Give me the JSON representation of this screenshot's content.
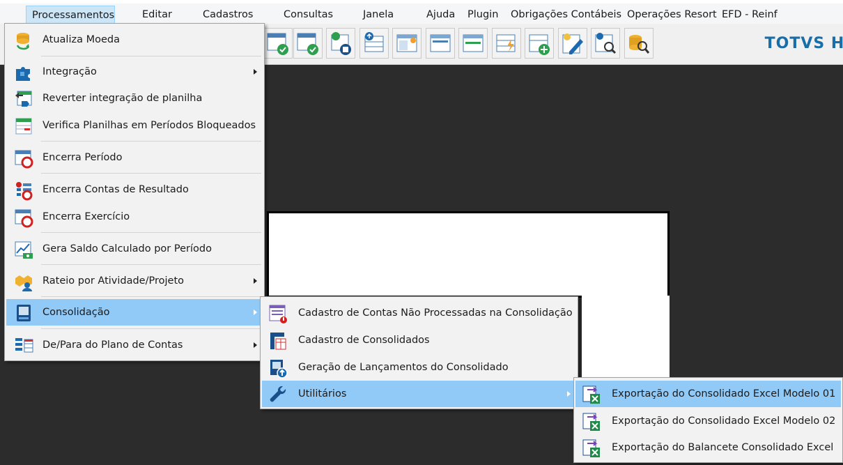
{
  "menubar": {
    "items": [
      "Processamentos",
      "Editar",
      "Cadastros",
      "Consultas",
      "Janela",
      "Ajuda",
      "Plugin",
      "Obrigações Contábeis",
      "Operações Resort",
      "EFD - Reinf"
    ]
  },
  "brand": "TOTVS HO",
  "main_menu": {
    "items": [
      {
        "label": "Atualiza Moeda",
        "icon": "currency-refresh-icon"
      },
      {
        "label": "Integração",
        "icon": "puzzle-icon",
        "submenu": true
      },
      {
        "label": "Reverter integração de planilha",
        "icon": "spreadsheet-revert-icon"
      },
      {
        "label": "Verifica Planilhas em Períodos Bloqueados",
        "icon": "spreadsheet-check-icon"
      },
      {
        "label": "Encerra Período",
        "icon": "calendar-close-icon"
      },
      {
        "label": "Encerra Contas de Resultado",
        "icon": "list-close-icon"
      },
      {
        "label": "Encerra Exercício",
        "icon": "calendar-close-icon"
      },
      {
        "label": "Gera Saldo Calculado por Período",
        "icon": "chart-money-icon"
      },
      {
        "label": "Rateio por Atividade/Projeto",
        "icon": "people-share-icon",
        "submenu": true
      },
      {
        "label": "Consolidação",
        "icon": "book-icon",
        "submenu": true
      },
      {
        "label": "De/Para do Plano de Contas",
        "icon": "mapping-icon",
        "submenu": true
      }
    ]
  },
  "consolidation_menu": {
    "items": [
      {
        "label": "Cadastro de Contas Não Processadas na Consolidação",
        "icon": "list-alert-icon"
      },
      {
        "label": "Cadastro de Consolidados",
        "icon": "document-grid-icon"
      },
      {
        "label": "Geração de Lançamentos do Consolidado",
        "icon": "document-upload-icon"
      },
      {
        "label": "Utilitários",
        "icon": "wrench-icon",
        "submenu": true
      }
    ]
  },
  "utilities_menu": {
    "items": [
      {
        "label": "Exportação do Consolidado Excel Modelo 01",
        "icon": "excel-export-icon"
      },
      {
        "label": "Exportação do Consolidado Excel Modelo 02",
        "icon": "excel-export-icon"
      },
      {
        "label": "Exportação do Balancete Consolidado Excel",
        "icon": "excel-export-icon"
      }
    ]
  },
  "colors": {
    "highlight": "#91c9f7",
    "menubar_active": "#cde6f7",
    "workspace": "#2c2c2c",
    "brand": "#1a6ea8"
  }
}
